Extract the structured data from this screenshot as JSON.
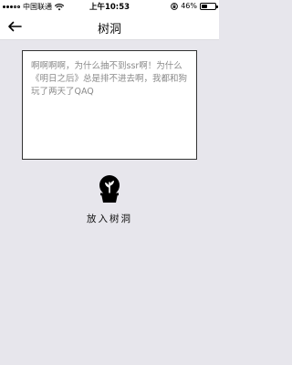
{
  "status_bar": {
    "carrier": "中国联通",
    "time": "上午10:53",
    "battery": "46%",
    "battery_level": 0.46
  },
  "nav": {
    "title": "树洞"
  },
  "message": {
    "text": "啊啊啊啊，为什么抽不到ssr啊！为什么《明日之后》总是排不进去啊，我都和狗玩了两天了QAQ"
  },
  "action": {
    "label": "放入树洞"
  }
}
